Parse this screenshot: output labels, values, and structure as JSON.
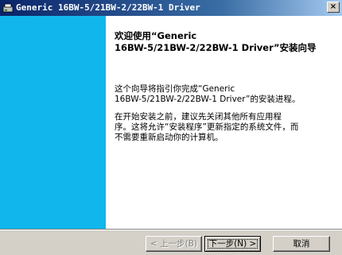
{
  "window": {
    "title": "Generic 16BW-5/21BW-2/22BW-1 Driver",
    "close_glyph": "×",
    "title_icon": "installer-icon"
  },
  "colors": {
    "titlebar_start": "#0a246a",
    "side_panel": "#11b7ec",
    "content_bg": "#ffffff",
    "dialog_bg": "#d4d0c8"
  },
  "wizard": {
    "heading_line1": "欢迎使用“Generic",
    "heading_line2": "16BW-5/21BW-2/22BW-1 Driver”安装向导",
    "para1_line1": "这个向导将指引你完成“Generic",
    "para1_line2": "16BW-5/21BW-2/22BW-1 Driver”的安装进程。",
    "para2_line1": "在开始安装之前，建议先关闭其他所有应用程",
    "para2_line2": "序。这将允许“安装程序”更新指定的系统文件，而",
    "para2_line3": "不需要重新启动你的计算机。"
  },
  "buttons": {
    "back": "< 上一步(B)",
    "next": "下一步(N) >",
    "cancel": "取消"
  }
}
